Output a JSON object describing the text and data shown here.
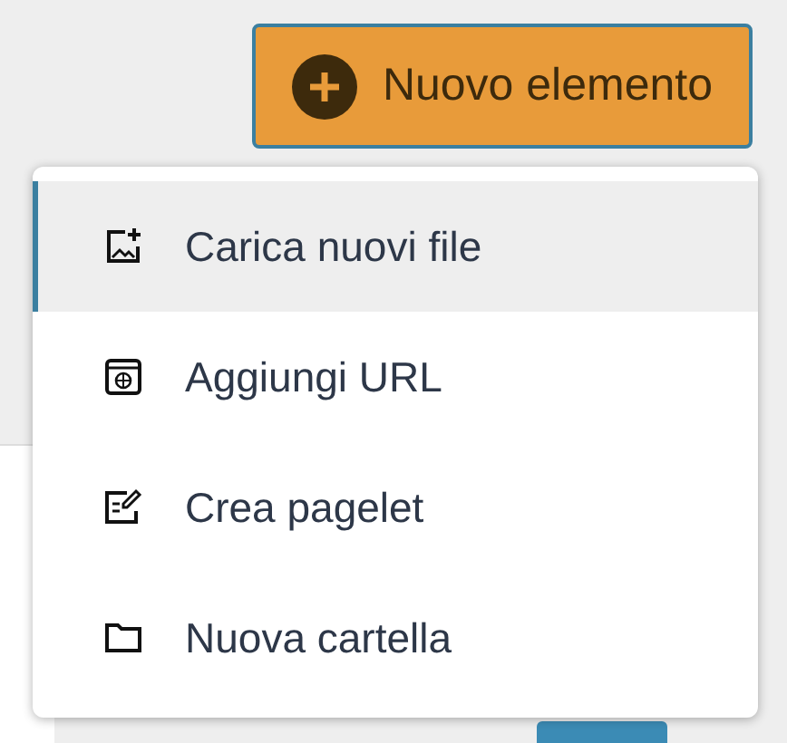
{
  "new_button": {
    "label": "Nuovo elemento"
  },
  "menu": {
    "items": [
      {
        "kind": "upload",
        "label": "Carica nuovi file",
        "selected": true
      },
      {
        "kind": "url",
        "label": "Aggiungi URL",
        "selected": false
      },
      {
        "kind": "pagelet",
        "label": "Crea pagelet",
        "selected": false
      },
      {
        "kind": "folder",
        "label": "Nuova cartella",
        "selected": false
      }
    ]
  }
}
